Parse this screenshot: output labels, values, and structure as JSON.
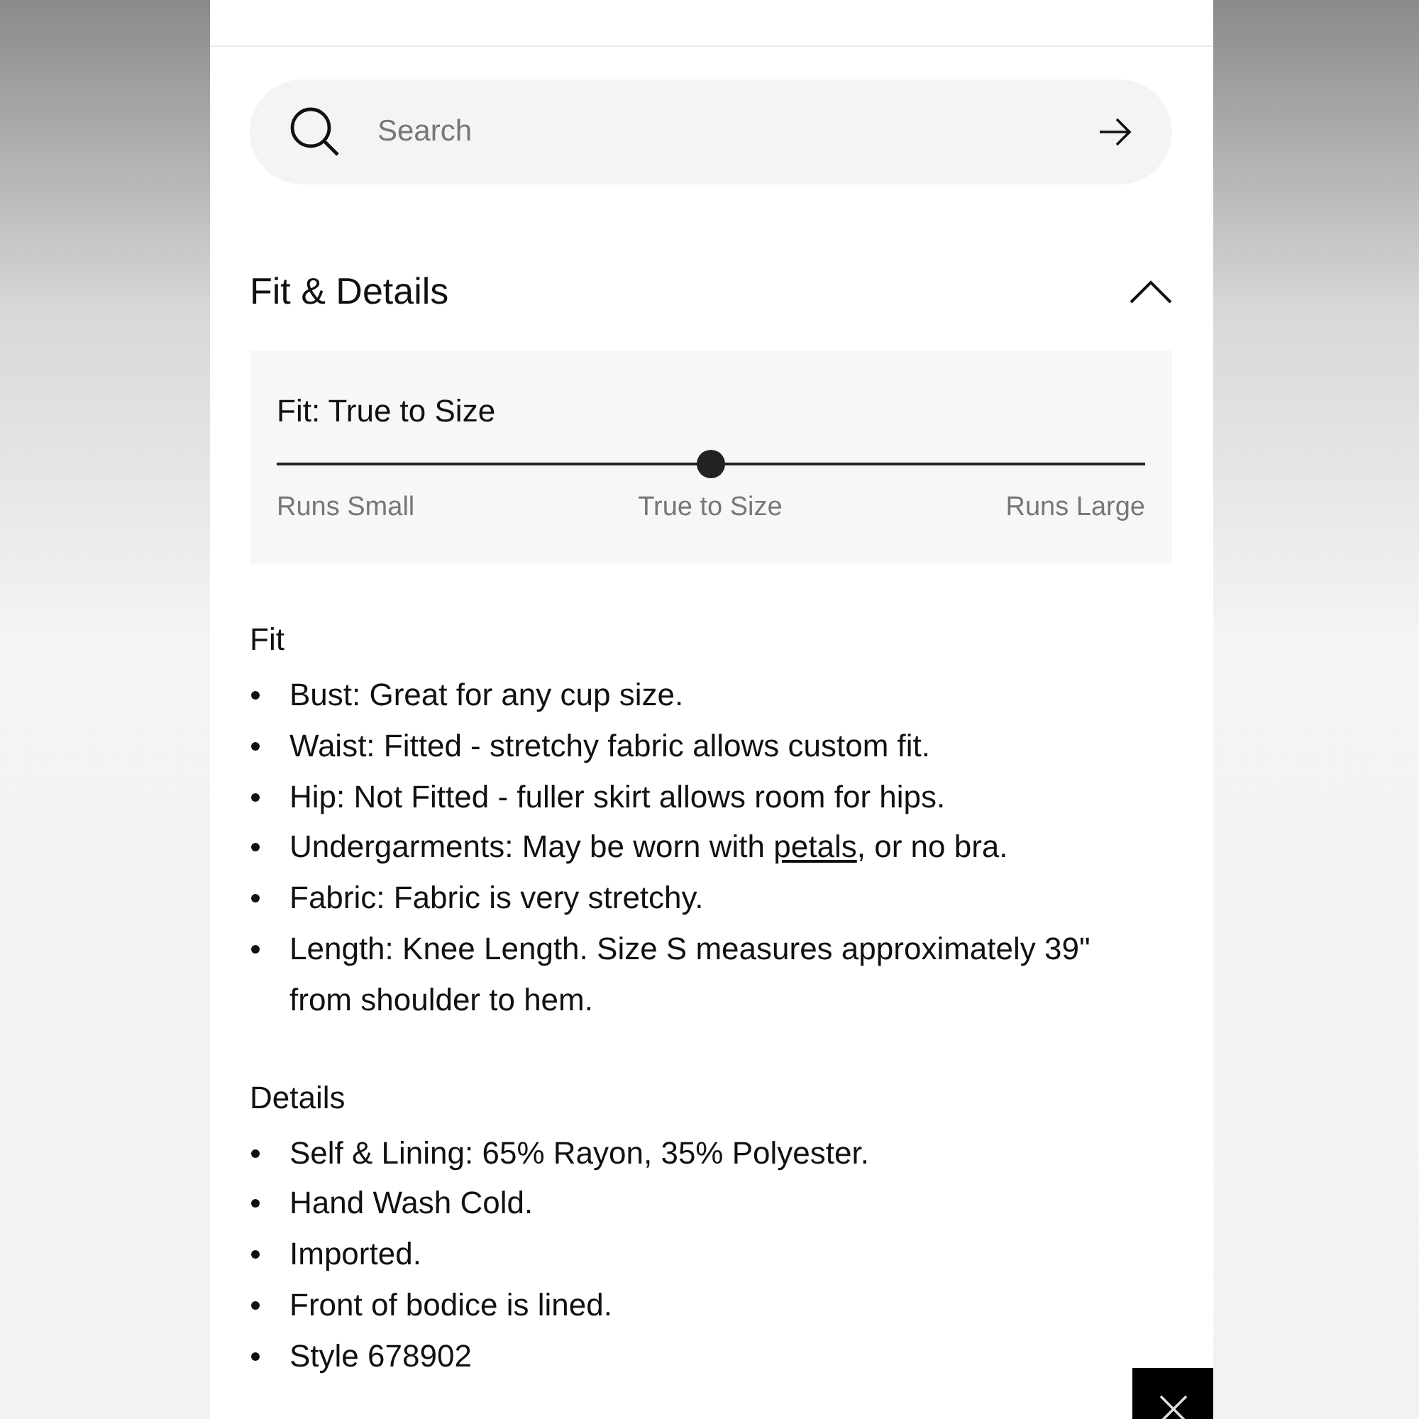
{
  "search": {
    "placeholder": "Search"
  },
  "section": {
    "title": "Fit & Details",
    "expanded": true,
    "fit": {
      "label": "Fit: True to Size",
      "level": 0.5,
      "scale_labels": [
        "Runs Small",
        "True to Size",
        "Runs Large"
      ]
    },
    "groups": [
      {
        "heading": "Fit",
        "items": [
          {
            "segments": [
              {
                "kind": "text",
                "text": "Bust: Great for any cup size."
              }
            ]
          },
          {
            "segments": [
              {
                "kind": "text",
                "text": "Waist: Fitted - stretchy fabric allows custom fit."
              }
            ]
          },
          {
            "segments": [
              {
                "kind": "text",
                "text": "Hip: Not Fitted - fuller skirt allows room for hips."
              }
            ]
          },
          {
            "segments": [
              {
                "kind": "text",
                "text": "Undergarments: May be worn with "
              },
              {
                "kind": "link",
                "text": "petals"
              },
              {
                "kind": "text",
                "text": ", or no bra."
              }
            ]
          },
          {
            "segments": [
              {
                "kind": "text",
                "text": "Fabric: Fabric is very stretchy."
              }
            ]
          },
          {
            "segments": [
              {
                "kind": "text",
                "text": "Length: Knee Length. Size S measures approximately 39\" from shoulder to hem."
              }
            ]
          }
        ]
      },
      {
        "heading": "Details",
        "items": [
          {
            "segments": [
              {
                "kind": "text",
                "text": "Self & Lining: 65% Rayon, 35% Polyester."
              }
            ]
          },
          {
            "segments": [
              {
                "kind": "text",
                "text": "Hand Wash Cold."
              }
            ]
          },
          {
            "segments": [
              {
                "kind": "text",
                "text": "Imported."
              }
            ]
          },
          {
            "segments": [
              {
                "kind": "text",
                "text": "Front of bodice is lined."
              }
            ]
          },
          {
            "segments": [
              {
                "kind": "text",
                "text": "Style 678902"
              }
            ]
          }
        ]
      }
    ]
  }
}
